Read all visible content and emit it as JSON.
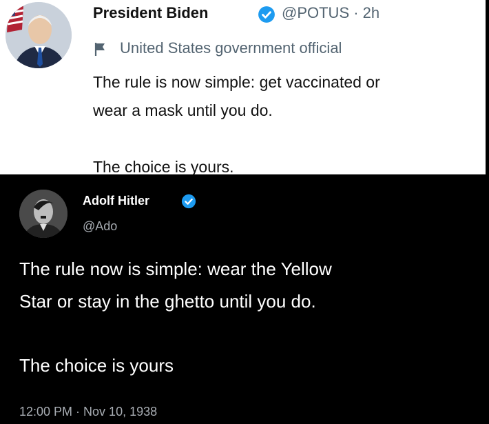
{
  "tweet_top": {
    "name": "President Biden",
    "handle_time": "@POTUS · 2h",
    "label": "United States government official",
    "lines": [
      "The rule is now simple: get vaccinated or",
      "wear a mask until you do.",
      "The choice is yours."
    ],
    "icons": {
      "badge": "verified-badge-icon",
      "flag": "flag-icon"
    },
    "colors": {
      "badge": "#1d9bf0",
      "secondary_text": "#536471"
    }
  },
  "tweet_bottom": {
    "name": "Adolf Hitler",
    "handle": "@Ado",
    "lines": [
      "The rule now is simple: wear the Yellow",
      "Star or stay in the ghetto until you do.",
      "The choice is yours"
    ],
    "timestamp": "12:00 PM · Nov 10, 1938",
    "icons": {
      "badge": "verified-badge-icon"
    },
    "colors": {
      "badge": "#1d9bf0",
      "background": "#000000"
    }
  }
}
